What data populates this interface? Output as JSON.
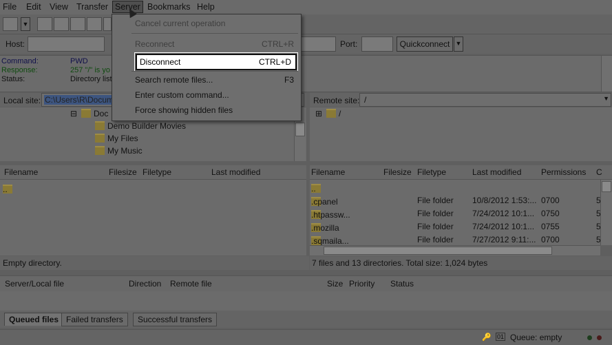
{
  "menubar": {
    "items": [
      "File",
      "Edit",
      "View",
      "Transfer",
      "Server",
      "Bookmarks",
      "Help"
    ]
  },
  "quickconnect": {
    "host_label": "Host:",
    "port_label": "Port:",
    "button_label": "Quickconnect"
  },
  "log": {
    "lines": [
      {
        "key": "Command:",
        "value": "PWD",
        "color": "#10104a"
      },
      {
        "key": "Response:",
        "value": "257 \"/\" is yo",
        "color": "#0f4a0f"
      },
      {
        "key": "Status:",
        "value": "Directory list",
        "color": "#111111"
      }
    ]
  },
  "local": {
    "site_label": "Local site:",
    "site_value": "C:\\Users\\R\\Docume",
    "tree": [
      "Doc",
      "Demo Builder Movies",
      "My Files",
      "My Music"
    ],
    "columns": [
      "Filename",
      "Filesize",
      "Filetype",
      "Last modified"
    ],
    "rows": [
      ".."
    ],
    "status": "Empty directory."
  },
  "remote": {
    "site_label": "Remote site:",
    "site_value": "/",
    "tree_root": "/",
    "columns": [
      "Filename",
      "Filesize",
      "Filetype",
      "Last modified",
      "Permissions",
      "C"
    ],
    "rows": [
      {
        "name": "..",
        "type": "",
        "modified": "",
        "perm": "",
        "c": ""
      },
      {
        "name": ".cpanel",
        "type": "File folder",
        "modified": "10/8/2012 1:53:...",
        "perm": "0700",
        "c": "5"
      },
      {
        "name": ".htpassw...",
        "type": "File folder",
        "modified": "7/24/2012 10:1...",
        "perm": "0750",
        "c": "5"
      },
      {
        "name": ".mozilla",
        "type": "File folder",
        "modified": "7/24/2012 10:1...",
        "perm": "0755",
        "c": "5"
      },
      {
        "name": ".sqmaila...",
        "type": "File folder",
        "modified": "7/27/2012 9:11:...",
        "perm": "0700",
        "c": "5"
      }
    ],
    "status": "7 files and 13 directories. Total size: 1,024 bytes"
  },
  "queue": {
    "columns": [
      "Server/Local file",
      "Direction",
      "Remote file",
      "Size",
      "Priority",
      "Status"
    ],
    "tabs": [
      "Queued files",
      "Failed transfers",
      "Successful transfers"
    ],
    "status": "Queue: empty"
  },
  "server_menu": {
    "items": [
      {
        "label": "Cancel current operation",
        "shortcut": "",
        "disabled": true
      },
      {
        "label": "Reconnect",
        "shortcut": "CTRL+R",
        "disabled": true
      },
      {
        "label": "Disconnect",
        "shortcut": "CTRL+D",
        "highlighted": true
      },
      {
        "label": "Search remote files...",
        "shortcut": "F3"
      },
      {
        "label": "Enter custom command...",
        "shortcut": ""
      },
      {
        "label": "Force showing hidden files",
        "shortcut": ""
      }
    ]
  },
  "colors": {
    "overlay_gray": "#6b6b6b",
    "highlight_bg": "#ffffff",
    "selection_blue": "#3d5580"
  }
}
